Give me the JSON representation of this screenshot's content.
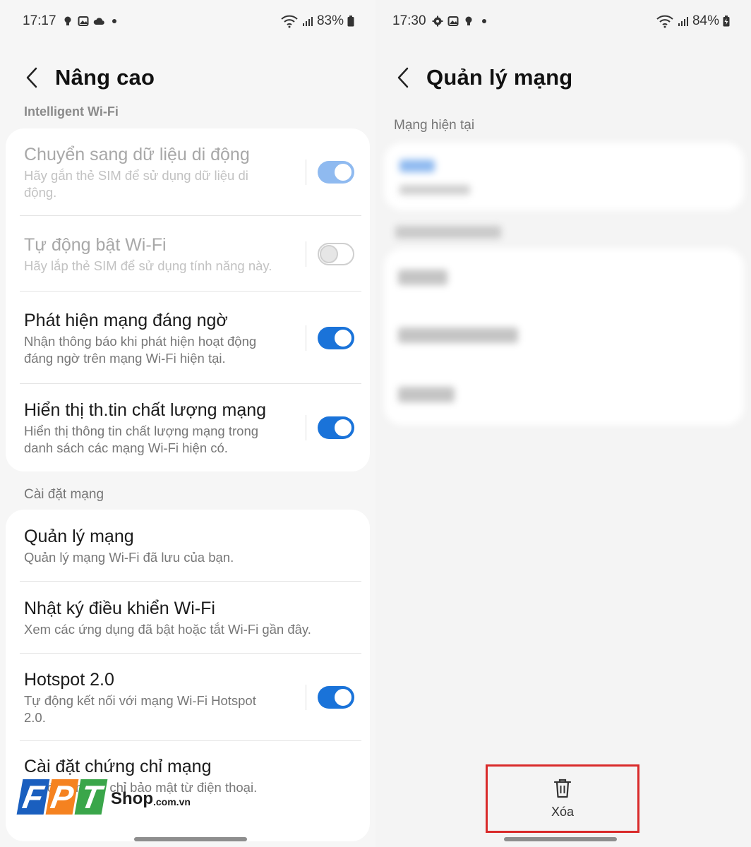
{
  "left": {
    "status": {
      "time": "17:17",
      "battery": "83%"
    },
    "title": "Nâng cao",
    "section_intelligent": "Intelligent Wi-Fi",
    "intelligent_items": [
      {
        "title": "Chuyển sang dữ liệu di động",
        "subtitle": "Hãy gắn thẻ SIM để sử dụng dữ liệu di động.",
        "toggle": "on",
        "enabled": false
      },
      {
        "title": "Tự động bật Wi-Fi",
        "subtitle": "Hãy lắp thẻ SIM để sử dụng tính năng này.",
        "toggle": "off",
        "enabled": false
      },
      {
        "title": "Phát hiện mạng đáng ngờ",
        "subtitle": "Nhận thông báo khi phát hiện hoạt động đáng ngờ trên mạng Wi-Fi hiện tại.",
        "toggle": "on",
        "enabled": true
      },
      {
        "title": "Hiển thị th.tin chất lượng mạng",
        "subtitle": "Hiển thị thông tin chất lượng mạng trong danh sách các mạng Wi-Fi hiện có.",
        "toggle": "on",
        "enabled": true
      }
    ],
    "section_network": "Cài đặt mạng",
    "network_items": [
      {
        "title": "Quản lý mạng",
        "subtitle": "Quản lý mạng Wi-Fi đã lưu của bạn."
      },
      {
        "title": "Nhật ký điều khiển Wi-Fi",
        "subtitle": "Xem các ứng dụng đã bật hoặc tắt Wi-Fi gần đây."
      },
      {
        "title": "Hotspot 2.0",
        "subtitle": "Tự động kết nối với mạng Wi-Fi Hotspot 2.0.",
        "toggle": "on"
      },
      {
        "title": "Cài đặt chứng chỉ mạng",
        "subtitle": "Cài đặt chứng chỉ bảo mật từ điện thoại."
      }
    ]
  },
  "right": {
    "status": {
      "time": "17:30",
      "battery": "84%"
    },
    "title": "Quản lý mạng",
    "section_current": "Mạng hiện tại",
    "delete_label": "Xóa"
  },
  "watermark": {
    "letters": [
      "F",
      "P",
      "T"
    ],
    "shop": "Shop",
    "domain": ".com.vn"
  },
  "colors": {
    "accent": "#1a73d9",
    "highlight_border": "#d92a2a",
    "fpt_blue": "#1a5fbf",
    "fpt_orange": "#f58220",
    "fpt_green": "#3aa64a"
  }
}
